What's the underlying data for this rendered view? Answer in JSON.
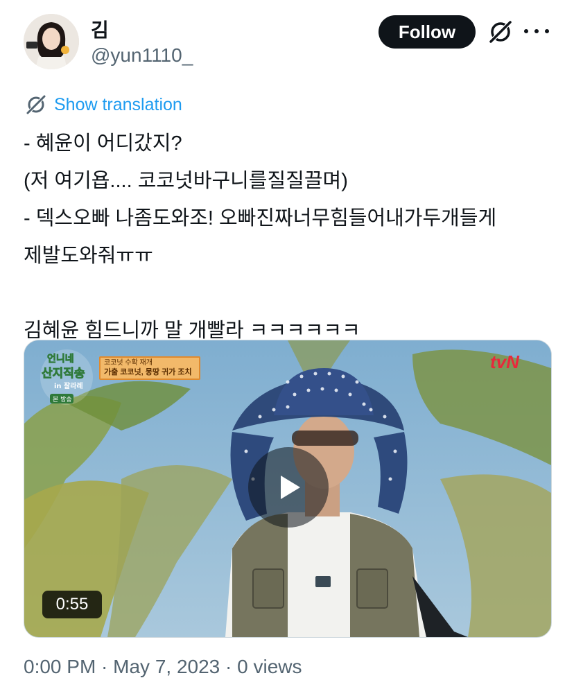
{
  "author": {
    "display_name": "김",
    "handle": "@yun1110_"
  },
  "header": {
    "follow_label": "Follow"
  },
  "tweet": {
    "translate_label": "Show translation",
    "text": "- 혜윤이 어디갔지?\n(저 여기욥.... 코코넛바구니를질질끌며)\n- 덱스오빠 나좀도와조! 오빠진짜너무힘들어내가두개들게\n제발도와줘ㅠㅠ\n\n김혜윤 힘드니까 말 개빨라 ㅋㅋㅋㅋㅋㅋ"
  },
  "media": {
    "duration": "0:55",
    "show_logo_line1": "언니네",
    "show_logo_line2": "산지직송",
    "show_logo_line3": "in 잘라레",
    "show_logo_tag": "본 방송",
    "caption_line1": "코코넛 수확 재개",
    "caption_line2": "가출 코코넛, 몽땅 귀가 조치",
    "channel_logo": "tvN"
  },
  "footer": {
    "timestamp_partial": "0:00 PM · May 7, 2023 · 0 views"
  },
  "colors": {
    "link": "#1d9bf0",
    "follow_bg": "#0f1419",
    "secondary_text": "#536471"
  },
  "icons": {
    "grok": "grok-icon",
    "more": "more-icon",
    "translate": "translate-icon",
    "play": "play-icon"
  }
}
